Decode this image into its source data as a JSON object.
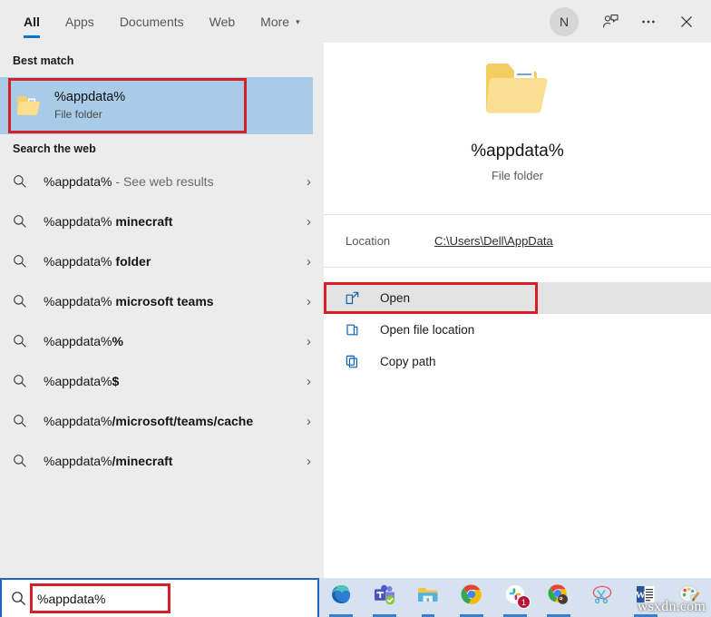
{
  "header": {
    "tabs": [
      {
        "label": "All",
        "active": true
      },
      {
        "label": "Apps",
        "active": false
      },
      {
        "label": "Documents",
        "active": false
      },
      {
        "label": "Web",
        "active": false
      },
      {
        "label": "More",
        "active": false,
        "caret": "▾"
      }
    ],
    "avatar_initial": "N",
    "feedback_icon": "feedback-person-icon",
    "more_icon": "ellipsis-icon",
    "close_icon": "close-icon"
  },
  "left": {
    "best_match_label": "Best match",
    "best_match": {
      "title": "%appdata%",
      "subtitle": "File folder",
      "icon": "folder-icon"
    },
    "web_label": "Search the web",
    "web_items": [
      {
        "query": "%appdata%",
        "suffix": "",
        "trailer": " - See web results"
      },
      {
        "query": "%appdata%",
        "suffix": " minecraft",
        "trailer": ""
      },
      {
        "query": "%appdata%",
        "suffix": " folder",
        "trailer": ""
      },
      {
        "query": "%appdata%",
        "suffix": " microsoft teams",
        "trailer": ""
      },
      {
        "query": "%appdata%",
        "suffix": "%",
        "trailer": ""
      },
      {
        "query": "%appdata%",
        "suffix": "$",
        "trailer": ""
      },
      {
        "query": "%appdata%",
        "suffix": "/microsoft/teams/cache",
        "trailer": ""
      },
      {
        "query": "%appdata%",
        "suffix": "/minecraft",
        "trailer": ""
      }
    ],
    "chevron": "›"
  },
  "preview": {
    "title": "%appdata%",
    "subtitle": "File folder",
    "icon": "large-folder-icon",
    "location_label": "Location",
    "location_value": "C:\\Users\\Dell\\AppData",
    "actions": [
      {
        "label": "Open",
        "icon": "open-external-icon",
        "highlighted": true
      },
      {
        "label": "Open file location",
        "icon": "folder-open-icon",
        "highlighted": false
      },
      {
        "label": "Copy path",
        "icon": "copy-icon",
        "highlighted": false
      }
    ]
  },
  "taskbar": {
    "search_value": "%appdata%",
    "search_icon": "search-icon",
    "items": [
      {
        "name": "edge-icon",
        "badge": null,
        "underline": "full"
      },
      {
        "name": "teams-icon",
        "badge": null,
        "underline": "full"
      },
      {
        "name": "file-explorer-icon",
        "badge": null,
        "underline": "short"
      },
      {
        "name": "chrome-icon",
        "badge": null,
        "underline": "full"
      },
      {
        "name": "slack-icon",
        "badge": "1",
        "underline": "full"
      },
      {
        "name": "chrome-profile-icon",
        "badge": null,
        "underline": "full"
      },
      {
        "name": "snipping-tool-icon",
        "badge": null,
        "underline": "none"
      },
      {
        "name": "word-icon",
        "badge": null,
        "underline": "full"
      },
      {
        "name": "paint-icon",
        "badge": null,
        "underline": "none"
      }
    ],
    "watermark": "wsxdn.com"
  },
  "colors": {
    "accent": "#0078d4",
    "selection": "#a8cbe8",
    "annotation": "#d61f26",
    "panel_gray": "#ececec",
    "taskbar": "#d6e2ef"
  }
}
